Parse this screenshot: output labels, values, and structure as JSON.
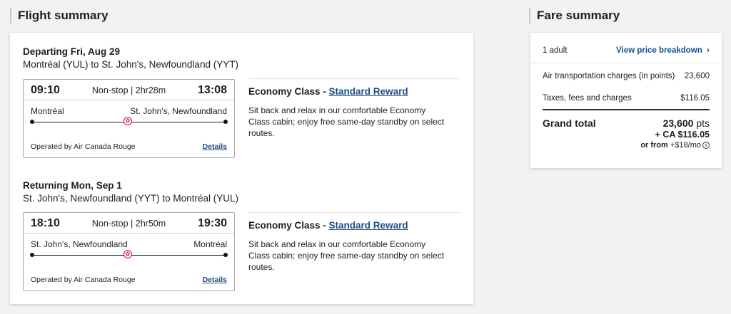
{
  "flight_summary": {
    "heading": "Flight summary",
    "bounds": [
      {
        "title": "Departing Fri, Aug 29",
        "route": "Montréal (YUL) to St. John's, Newfoundland (YYT)",
        "depart_time": "09:10",
        "arrive_time": "13:08",
        "stops": "Non-stop | 2hr28m",
        "origin_city": "Montréal",
        "dest_city": "St. John's, Newfoundland",
        "operated_by": "Operated by Air Canada Rouge",
        "details_label": "Details",
        "cabin_class": "Economy Class - ",
        "fare_name": "Standard Reward",
        "cabin_desc": "Sit back and relax in our comfortable Economy Class cabin; enjoy free same-day standby on select routes."
      },
      {
        "title": "Returning Mon, Sep 1",
        "route": "St. John's, Newfoundland (YYT) to Montréal (YUL)",
        "depart_time": "18:10",
        "arrive_time": "19:30",
        "stops": "Non-stop | 2hr50m",
        "origin_city": "St. John's, Newfoundland",
        "dest_city": "Montréal",
        "operated_by": "Operated by Air Canada Rouge",
        "details_label": "Details",
        "cabin_class": "Economy Class - ",
        "fare_name": "Standard Reward",
        "cabin_desc": "Sit back and relax in our comfortable Economy Class cabin; enjoy free same-day standby on select routes."
      }
    ]
  },
  "fare_summary": {
    "heading": "Fare summary",
    "passengers": "1 adult",
    "breakdown_link": "View price breakdown",
    "air_label": "Air transportation charges (in points)",
    "air_value": "23,600",
    "taxes_label": "Taxes, fees and charges",
    "taxes_value": "$116.05",
    "grand_label": "Grand total",
    "grand_points": "23,600",
    "grand_points_unit": "pts",
    "grand_cash": "+ CA $116.05",
    "monthly_prefix": "or from ",
    "monthly_amount": "+$18/mo"
  },
  "colors": {
    "link": "#1a4f8a",
    "brand_red": "#c8102e"
  },
  "icons": {
    "chevron": "chevron-right-icon",
    "info": "info-icon",
    "leaf": "maple-leaf-icon"
  }
}
